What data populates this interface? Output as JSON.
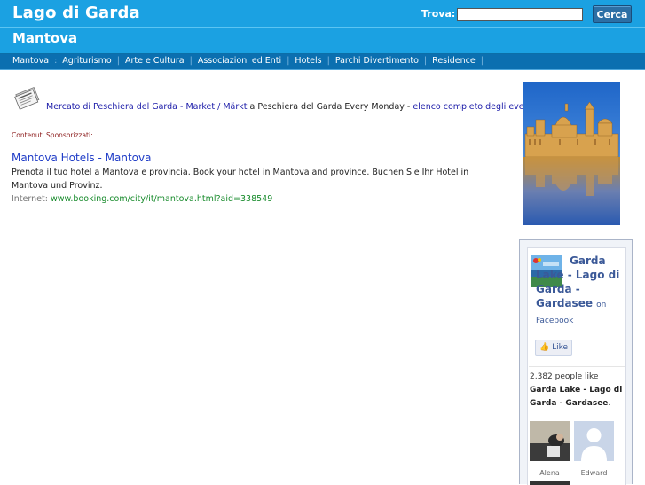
{
  "header": {
    "site_title": "Lago di Garda",
    "subtitle": "Mantova",
    "search_label": "Trova:",
    "search_value": "",
    "search_button": "Cerca"
  },
  "nav": {
    "items": [
      "Mantova",
      "Agriturismo",
      "Arte e Cultura",
      "Associazioni ed Enti",
      "Hotels",
      "Parchi Divertimento",
      "Residence"
    ],
    "first_separator": ":"
  },
  "news": {
    "icon": "newspaper-icon",
    "link_text": "Mercato di Peschiera del Garda - Market / Märkt",
    "middle_text": " a Peschiera del Garda Every Monday - ",
    "list_link": "elenco completo degli eventi"
  },
  "sponsored": {
    "label": "Contenuti Sponsorizzati:",
    "ad_title": "Mantova Hotels - Mantova",
    "ad_description": "Prenota il tuo hotel a Mantova e provincia. Book your hotel in Mantova and province. Buchen Sie Ihr Hotel in Mantova und Provinz.",
    "ad_url_label": "Internet:",
    "ad_url": "www.booking.com/city/it/mantova.html?aid=338549"
  },
  "sidebar": {
    "photo": "mantova-skyline-photo",
    "facebook": {
      "page_name": "Garda Lake - Lago di Garda - Gardasee",
      "on_text": "on Facebook",
      "like_label": "Like",
      "likes_count": "2,382",
      "likes_text": " people like ",
      "likes_page": "Garda Lake - Lago di Garda - Gardasee",
      "fans": [
        "Alena",
        "Edward"
      ]
    }
  },
  "colors": {
    "header": "#1ba1e2",
    "nav": "#0b6fb0",
    "link": "#1a1aa8",
    "ad_url": "#168a2a",
    "facebook": "#3b5998"
  }
}
